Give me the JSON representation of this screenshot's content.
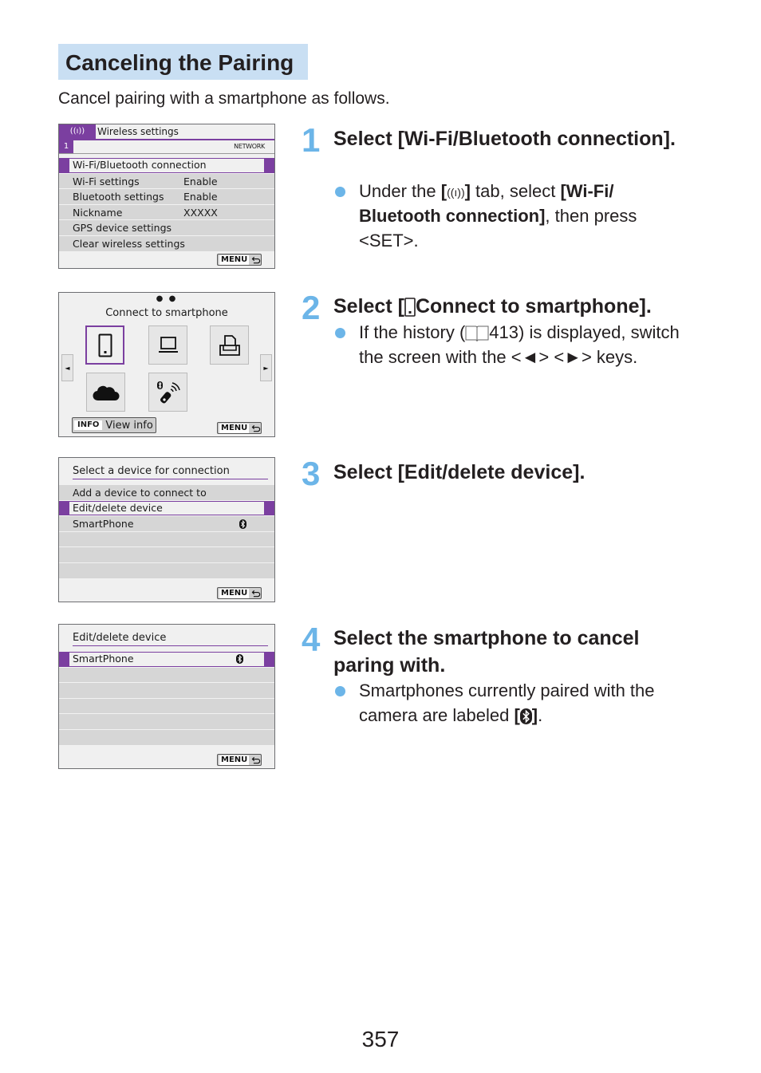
{
  "section": {
    "title": "Canceling the Pairing",
    "intro": "Cancel pairing with a smartphone as follows."
  },
  "screens": {
    "wireless_settings": {
      "tab_icon": "wireless-icon",
      "tab_title": "Wireless settings",
      "page": "1",
      "category": "NETWORK",
      "items": [
        {
          "label": "Wi-Fi/Bluetooth connection",
          "value": "",
          "selected": true
        },
        {
          "label": "Wi-Fi settings",
          "value": "Enable"
        },
        {
          "label": "Bluetooth settings",
          "value": "Enable"
        },
        {
          "label": "Nickname",
          "value": "XXXXX"
        },
        {
          "label": "GPS device settings",
          "value": ""
        },
        {
          "label": "Clear wireless settings",
          "value": ""
        }
      ],
      "menu_label": "MENU"
    },
    "connect": {
      "page_dots": "● ●",
      "title": "Connect to smartphone",
      "tiles": [
        "smartphone-icon",
        "computer-icon",
        "printer-icon",
        "cloud-icon",
        "bluetooth-remote-icon"
      ],
      "info_label": "INFO",
      "info_text": "View info",
      "menu_label": "MENU"
    },
    "select_device": {
      "header": "Select a device for connection",
      "items": [
        {
          "label": "Add a device to connect to"
        },
        {
          "label": "Edit/delete device",
          "selected": true
        },
        {
          "label": "SmartPhone",
          "icon": "bluetooth-icon"
        },
        {
          "label": ""
        },
        {
          "label": ""
        },
        {
          "label": ""
        }
      ],
      "menu_label": "MENU"
    },
    "edit_delete": {
      "header": "Edit/delete device",
      "items": [
        {
          "label": "SmartPhone",
          "icon": "bluetooth-icon",
          "selected": true
        },
        {
          "label": ""
        },
        {
          "label": ""
        },
        {
          "label": ""
        },
        {
          "label": ""
        },
        {
          "label": ""
        }
      ],
      "menu_label": "MENU"
    }
  },
  "steps": [
    {
      "number": "1",
      "heading": "Select [Wi-Fi/Bluetooth connection].",
      "bullet": {
        "t1": "Under the ",
        "b1": "[",
        "b2": "]",
        "t2": " tab, select ",
        "b3": "[Wi-Fi/ Bluetooth connection]",
        "t3": ", then press ",
        "t4": "<SET>."
      }
    },
    {
      "number": "2",
      "heading_pre": "Select [",
      "heading_post": "Connect to smartphone].",
      "bullet": {
        "t1": "If the history (",
        "page_ref": "413",
        "t2": ") is displayed, switch the screen with the <◄> <►> keys."
      }
    },
    {
      "number": "3",
      "heading": "Select [Edit/delete device]."
    },
    {
      "number": "4",
      "heading": "Select the smartphone to cancel paring with.",
      "bullet": {
        "t1": "Smartphones currently paired with the camera are labeled ",
        "b1": "[",
        "b2": "]",
        "t2": "."
      }
    }
  ],
  "page_number": "357"
}
